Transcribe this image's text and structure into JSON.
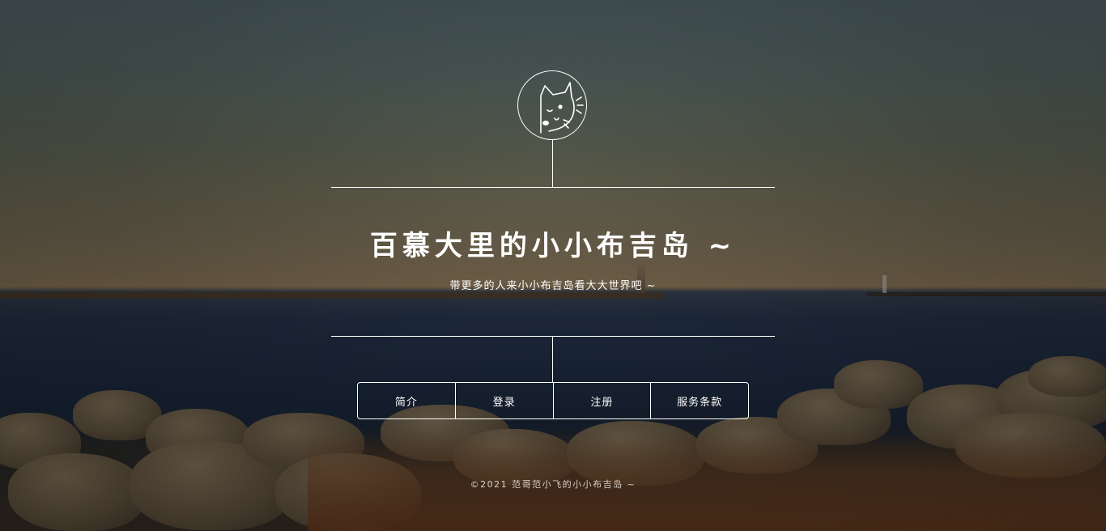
{
  "site": {
    "title": "百慕大里的小小布吉岛 ~",
    "subtitle": "带更多的人来小小布吉岛看大大世界吧 ~"
  },
  "avatar": {
    "icon": "peeking-cat-icon"
  },
  "nav": {
    "items": [
      {
        "label": "简介"
      },
      {
        "label": "登录"
      },
      {
        "label": "注册"
      },
      {
        "label": "服务条款"
      }
    ]
  },
  "footer": {
    "text": "©2021 范哥范小飞的小小布吉岛 ~"
  },
  "colors": {
    "foreground": "#ffffff",
    "footer_text": "#d8d2c8"
  }
}
